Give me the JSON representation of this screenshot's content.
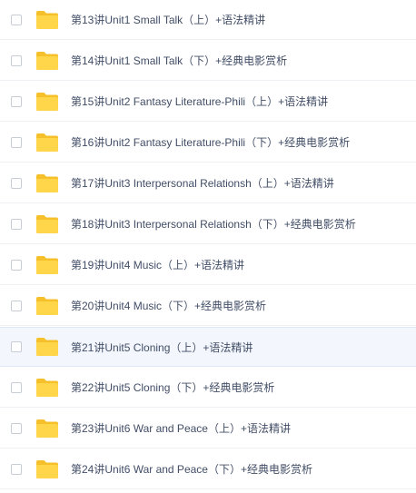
{
  "files": [
    {
      "name": "第13讲Unit1 Small Talk（上）+语法精讲",
      "icon": "folder-icon",
      "hovered": false
    },
    {
      "name": "第14讲Unit1 Small Talk（下）+经典电影赏析",
      "icon": "folder-icon",
      "hovered": false
    },
    {
      "name": "第15讲Unit2 Fantasy Literature-Phili（上）+语法精讲",
      "icon": "folder-icon",
      "hovered": false
    },
    {
      "name": "第16讲Unit2 Fantasy Literature-Phili（下）+经典电影赏析",
      "icon": "folder-icon",
      "hovered": false
    },
    {
      "name": "第17讲Unit3 Interpersonal Relationsh（上）+语法精讲",
      "icon": "folder-icon",
      "hovered": false
    },
    {
      "name": "第18讲Unit3 Interpersonal Relationsh（下）+经典电影赏析",
      "icon": "folder-icon",
      "hovered": false
    },
    {
      "name": "第19讲Unit4 Music（上）+语法精讲",
      "icon": "folder-icon",
      "hovered": false
    },
    {
      "name": "第20讲Unit4 Music（下）+经典电影赏析",
      "icon": "folder-icon",
      "hovered": false
    },
    {
      "name": "第21讲Unit5 Cloning（上）+语法精讲",
      "icon": "folder-icon",
      "hovered": true
    },
    {
      "name": "第22讲Unit5 Cloning（下）+经典电影赏析",
      "icon": "folder-icon",
      "hovered": false
    },
    {
      "name": "第23讲Unit6 War and Peace（上）+语法精讲",
      "icon": "folder-icon",
      "hovered": false
    },
    {
      "name": "第24讲Unit6 War and Peace（下）+经典电影赏析",
      "icon": "folder-icon",
      "hovered": false
    }
  ],
  "colors": {
    "folder_back": "#f5c02a",
    "folder_front": "#ffd54a",
    "text": "#424e67",
    "hover_bg": "#f3f7fd"
  }
}
